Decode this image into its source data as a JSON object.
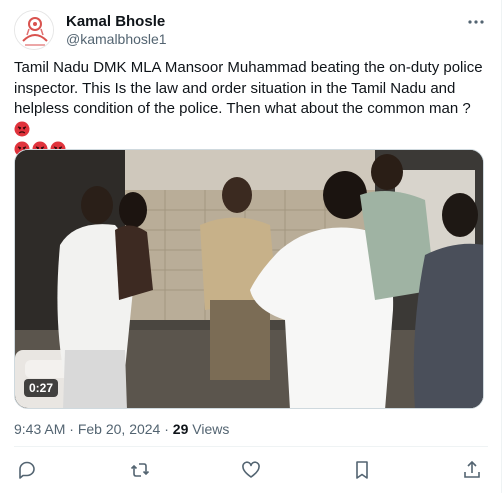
{
  "author": {
    "name": "Kamal Bhosle",
    "handle": "@kamalbhosle1"
  },
  "tweet": {
    "text": "Tamil Nadu DMK MLA Mansoor Muhammad beating the on-duty police inspector. This Is the law and order situation in the Tamil Nadu and helpless condition of the police. Then what about the common man ?",
    "emoji_name": "enraged-face-emoji",
    "emoji_count_inline": 1,
    "emoji_count_next_line": 3
  },
  "media": {
    "duration": "0:27"
  },
  "meta": {
    "time": "9:43 AM",
    "separator": "·",
    "date": "Feb 20, 2024",
    "views_count": "29",
    "views_label": "Views"
  },
  "icons": {
    "more": "more-dots-icon",
    "reply": "reply-icon",
    "retweet": "retweet-icon",
    "like": "like-icon",
    "bookmark": "bookmark-icon",
    "share": "share-icon"
  },
  "colors": {
    "text_primary": "#0f1419",
    "text_secondary": "#536471",
    "border": "#cfd9de",
    "emoji_red": "#e0333c"
  }
}
